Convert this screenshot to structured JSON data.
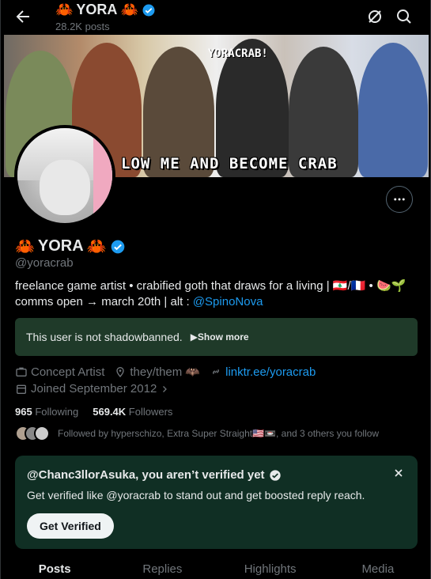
{
  "header": {
    "title": "YORA",
    "posts_count": "28.2K posts"
  },
  "banner": {
    "tag": "YORACRAB!",
    "caption": "LOW ME AND BECOME CRAB"
  },
  "profile": {
    "name": "YORA",
    "handle": "@yoracrab",
    "bio_text": "freelance game artist • crabified goth that draws for a living | 🇱🇧/🇫🇷 • 🍉🌱comms open → march 20th | alt : ",
    "bio_link": "@SpinoNova"
  },
  "shadowban": {
    "text": "This user is not shadowbanned.",
    "more": "▶Show more"
  },
  "meta": {
    "category": "Concept Artist",
    "pronouns": "they/them 🦇",
    "website": "linktr.ee/yoracrab",
    "joined": "Joined September 2012"
  },
  "stats": {
    "following_count": "965",
    "following_label": "Following",
    "followers_count": "569.4K",
    "followers_label": "Followers"
  },
  "followed_by": "Followed by hyperschizo, Extra Super Straight🇺🇸📼, and 3 others you follow",
  "verify_card": {
    "title": "@Chanc3llorAsuka, you aren’t verified yet",
    "body": "Get verified like @yoracrab to stand out and get boosted reply reach.",
    "button": "Get Verified"
  },
  "tabs": [
    "Posts",
    "Replies",
    "Highlights",
    "Media"
  ],
  "colors": {
    "accent": "#1d9bf0",
    "card_green": "#102f24",
    "shadowban_green": "#1f3a29",
    "crab": "#e0245e"
  }
}
